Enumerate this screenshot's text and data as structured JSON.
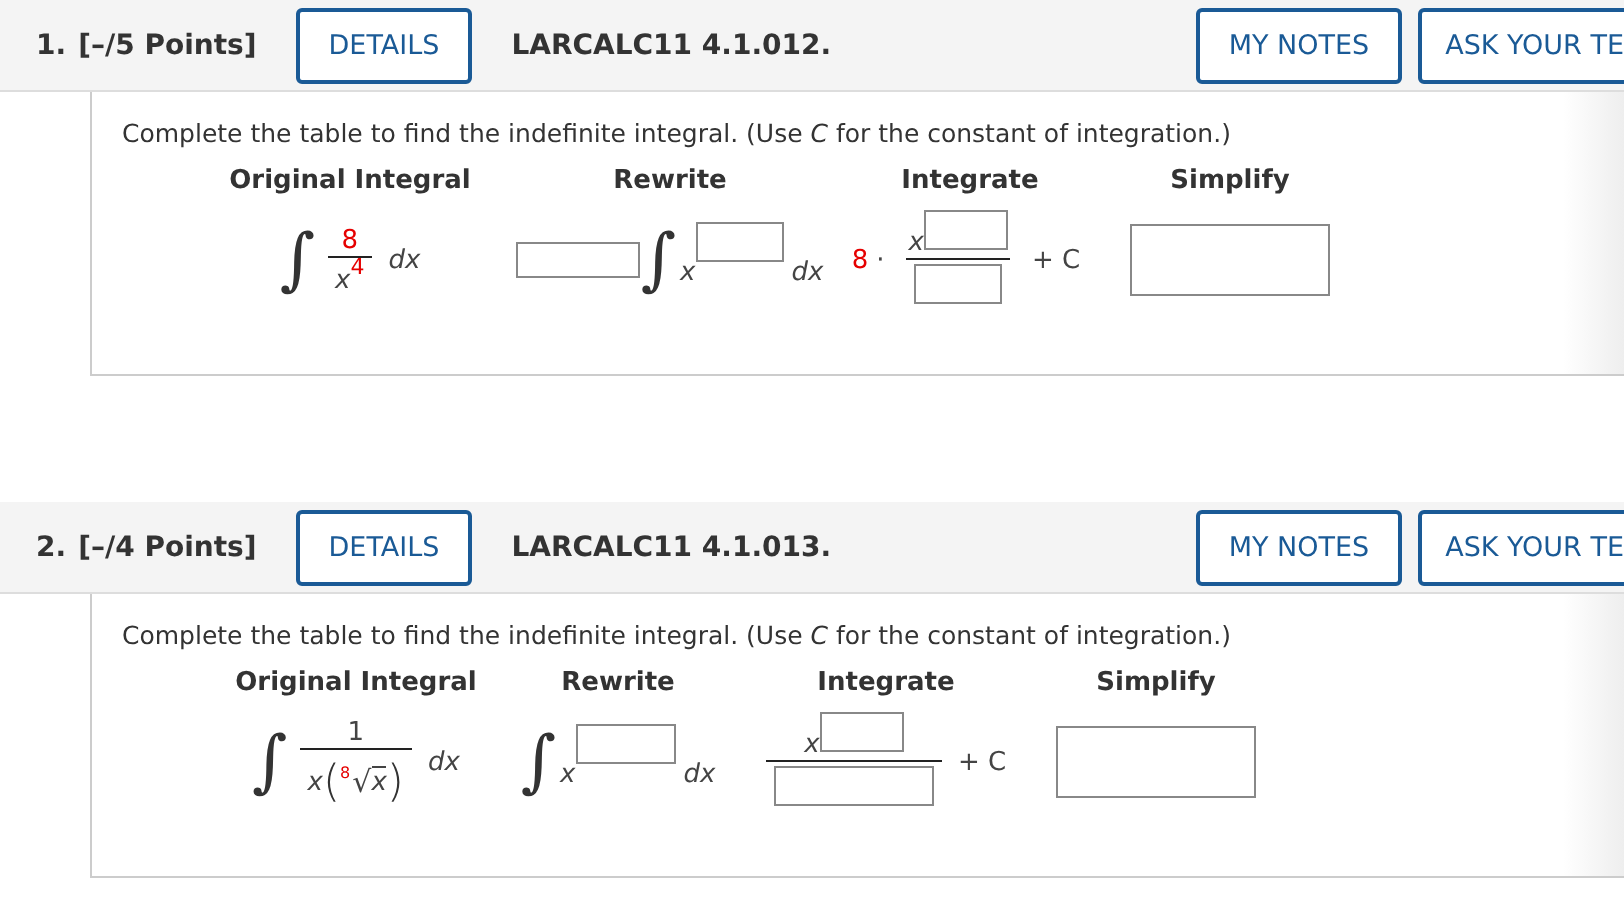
{
  "problems": [
    {
      "number": "1.",
      "points": "[–/5 Points]",
      "details_button": "DETAILS",
      "code": "LARCALC11 4.1.012.",
      "notes_button": "MY NOTES",
      "ask_button": "ASK YOUR TE",
      "instruction": "Complete the table to find the indefinite integral. (Use *C* for the constant of integration.)",
      "headers": [
        "Original Integral",
        "Rewrite",
        "Integrate",
        "Simplify"
      ],
      "original": {
        "kind": "power",
        "integral": "∫",
        "numerator": "8",
        "base": "x",
        "exponent": "4",
        "differential": "dx"
      },
      "rewrite": {
        "has_coefficient": true,
        "integral": "∫",
        "base": "x",
        "differential": "dx"
      },
      "integrate": {
        "coefficient": "8",
        "dot": "·",
        "base": "x",
        "constant": "+ C"
      }
    },
    {
      "number": "2.",
      "points": "[–/4 Points]",
      "details_button": "DETAILS",
      "code": "LARCALC11 4.1.013.",
      "notes_button": "MY NOTES",
      "ask_button": "ASK YOUR TE",
      "instruction": "Complete the table to find the indefinite integral. (Use *C* for the constant of integration.)",
      "headers": [
        "Original Integral",
        "Rewrite",
        "Integrate",
        "Simplify"
      ],
      "original": {
        "kind": "root",
        "integral": "∫",
        "numerator": "1",
        "base": "x",
        "open": "(",
        "index": "8",
        "radical": "√",
        "radicand": "x",
        "close": ")",
        "differential": "dx"
      },
      "rewrite": {
        "has_coefficient": false,
        "integral": "∫",
        "base": "x",
        "differential": "dx"
      },
      "integrate": {
        "base": "x",
        "constant": "+ C"
      }
    }
  ]
}
